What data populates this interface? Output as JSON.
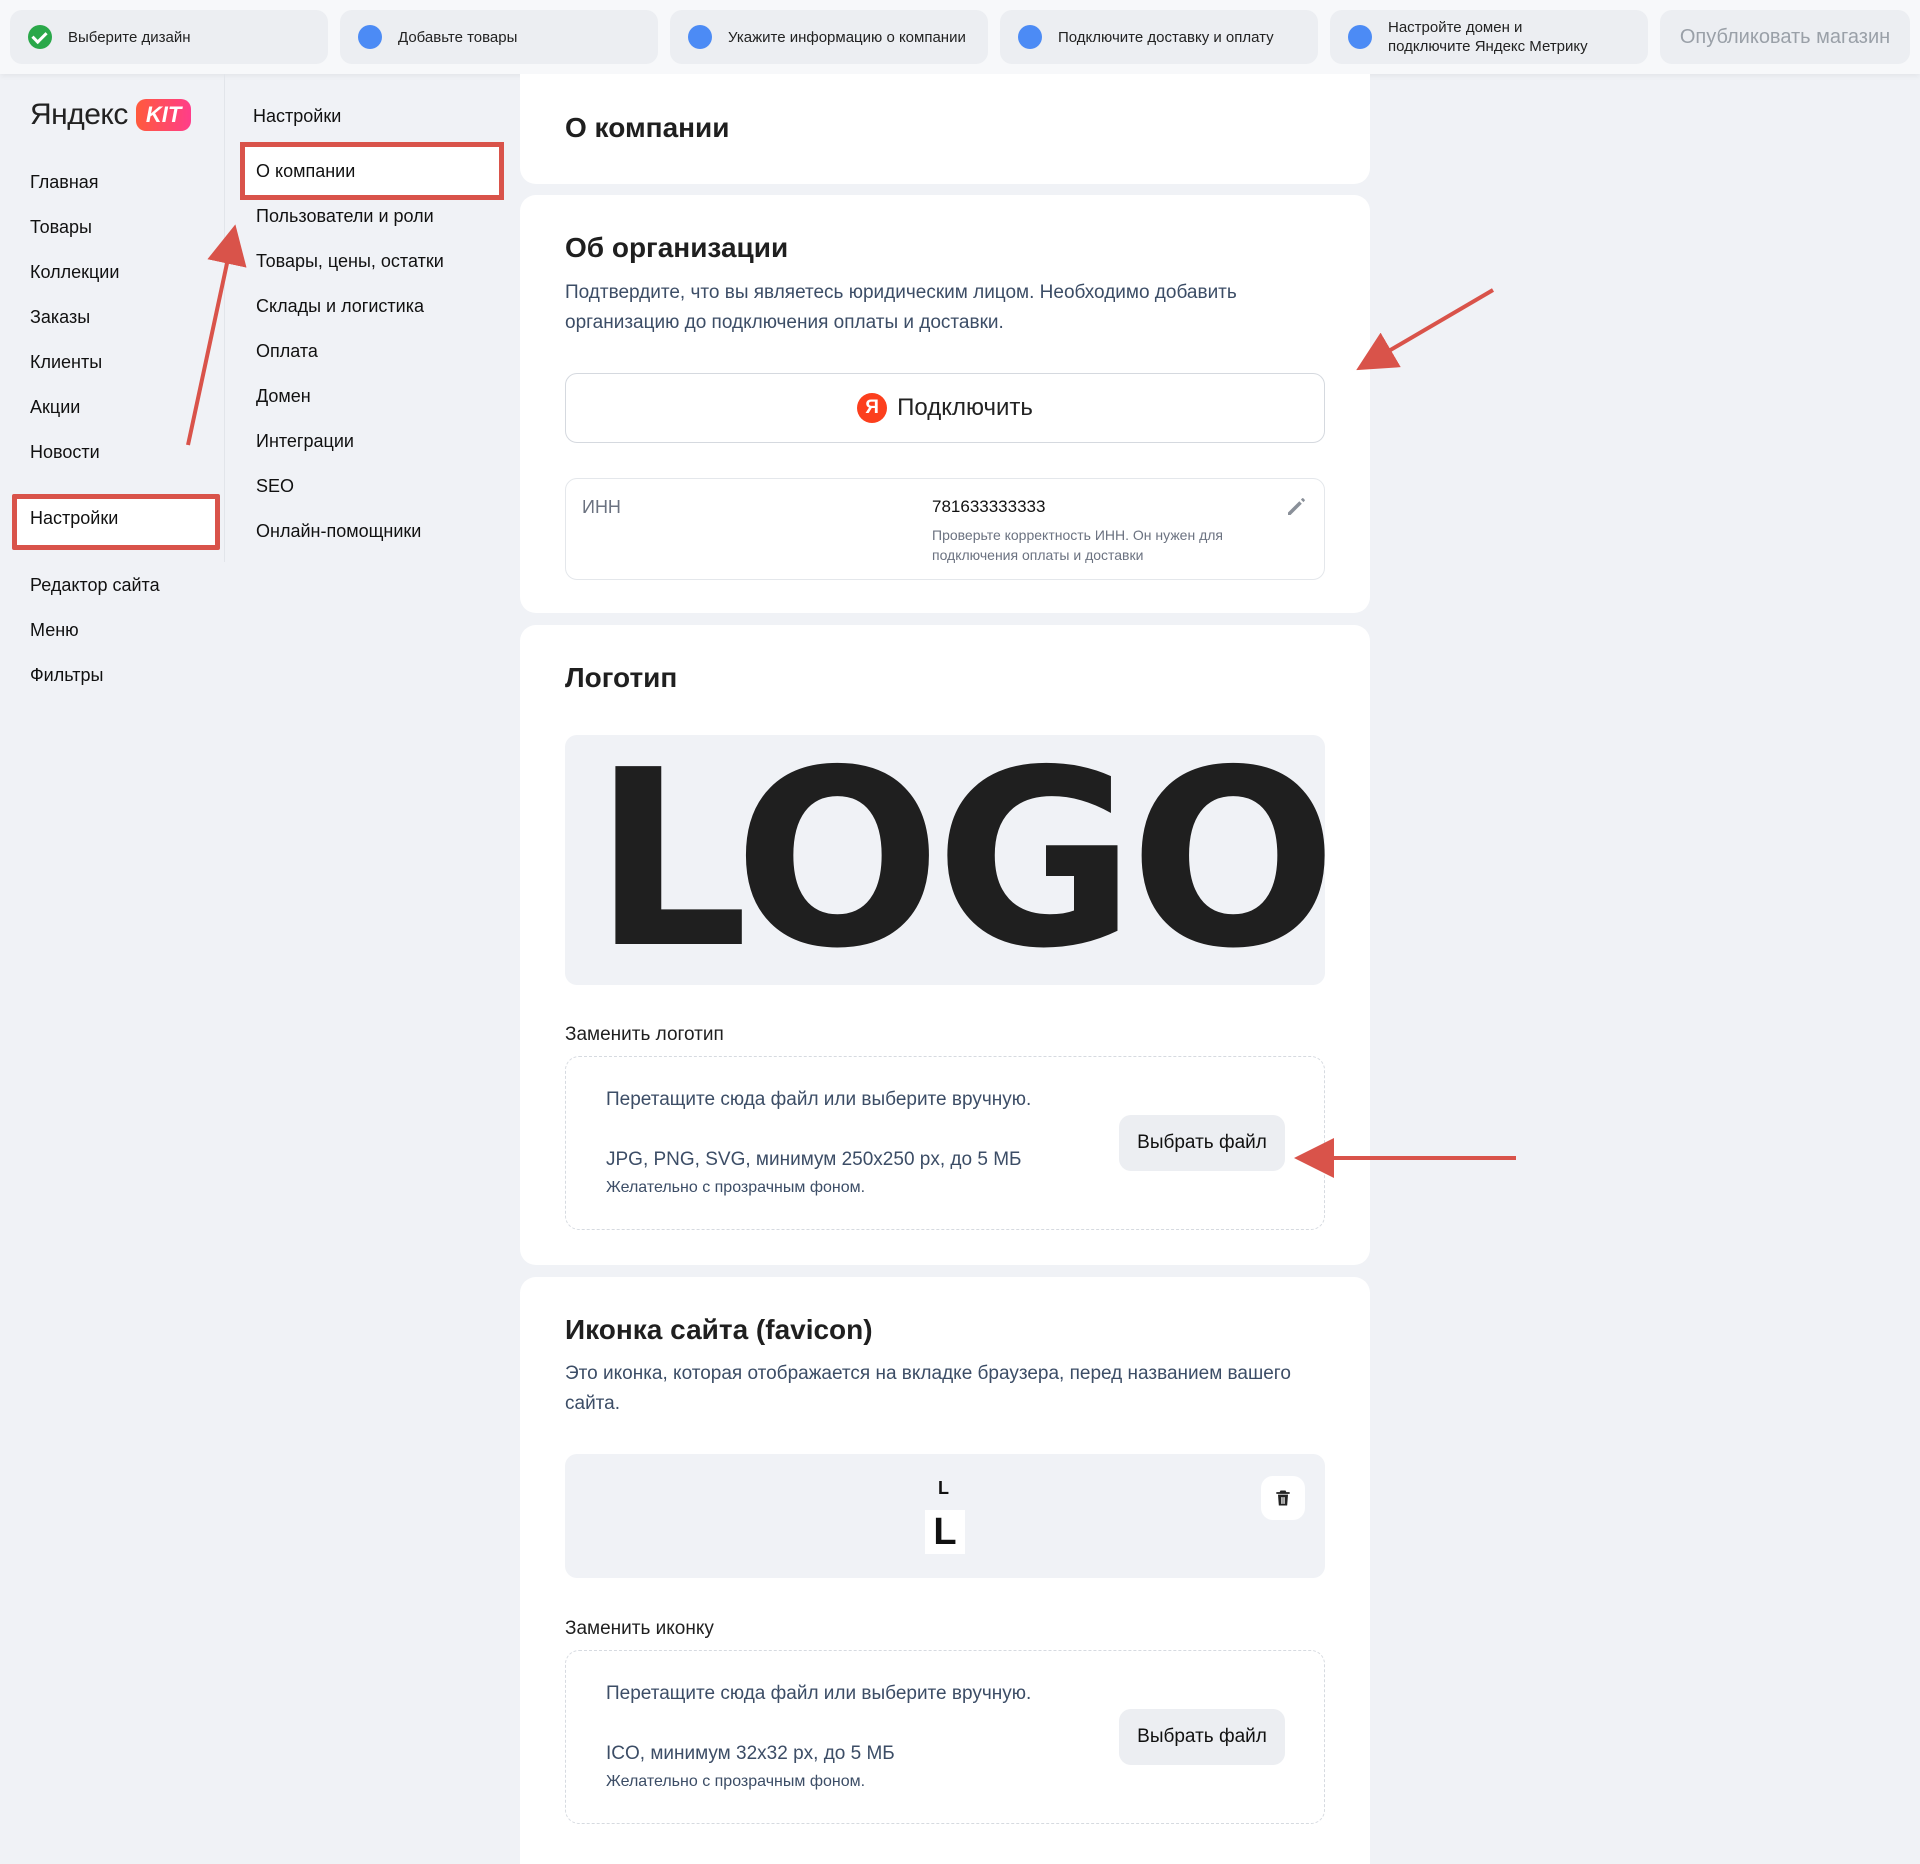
{
  "steps": [
    {
      "label": "Выберите дизайн",
      "done": true
    },
    {
      "label": "Добавьте товары",
      "done": false
    },
    {
      "label": "Укажите информацию о компании",
      "done": false
    },
    {
      "label": "Подключите доставку и оплату",
      "done": false
    },
    {
      "label": "Настройте домен и подключите Яндекс Метрику",
      "done": false
    }
  ],
  "publish_label": "Опубликовать магазин",
  "brand": {
    "name": "Яндекс",
    "badge": "KIT"
  },
  "sidebar": {
    "items": [
      {
        "label": "Главная"
      },
      {
        "label": "Товары"
      },
      {
        "label": "Коллекции"
      },
      {
        "label": "Заказы"
      },
      {
        "label": "Клиенты"
      },
      {
        "label": "Акции"
      },
      {
        "label": "Новости"
      },
      {
        "label": "Настройки",
        "selected": true
      },
      {
        "label": "Редактор сайта"
      },
      {
        "label": "Меню"
      },
      {
        "label": "Фильтры"
      }
    ]
  },
  "submenu": {
    "title": "Настройки",
    "items": [
      {
        "label": "О компании",
        "selected": true
      },
      {
        "label": "Пользователи и роли"
      },
      {
        "label": "Товары, цены, остатки"
      },
      {
        "label": "Склады и логистика"
      },
      {
        "label": "Оплата"
      },
      {
        "label": "Домен"
      },
      {
        "label": "Интеграции"
      },
      {
        "label": "SEO"
      },
      {
        "label": "Онлайн-помощники"
      }
    ]
  },
  "page_title": "О компании",
  "org": {
    "title": "Об организации",
    "description": "Подтвердите, что вы являетесь юридическим лицом. Необходимо добавить организацию до подключения оплаты и доставки.",
    "connect_label": "Подключить",
    "ya_letter": "Я",
    "inn_label": "ИНН",
    "inn_value": "781633333333",
    "inn_hint": "Проверьте корректность ИНН. Он нужен для подключения оплаты и доставки"
  },
  "logo": {
    "title": "Логотип",
    "preview_text": "LOGO",
    "replace_label": "Заменить логотип",
    "drop_text": "Перетащите сюда файл или выберите вручную.",
    "formats": "JPG, PNG, SVG, минимум 250x250 px, до 5 МБ",
    "hint": "Желательно с прозрачным фоном.",
    "choose_label": "Выбрать файл"
  },
  "favicon": {
    "title": "Иконка сайта (favicon)",
    "description": "Это иконка, которая отображается на вкладке браузера, перед названием вашего сайта.",
    "preview_small": "L",
    "preview_big": "L",
    "replace_label": "Заменить иконку",
    "drop_text": "Перетащите сюда файл или выберите вручную.",
    "formats": "ICO, минимум 32x32 px, до 5 МБ",
    "hint": "Желательно с прозрачным фоном.",
    "choose_label": "Выбрать файл"
  },
  "colors": {
    "accent_blue": "#4c8bf5",
    "done_green": "#2aa84a",
    "highlight_red": "#d9534a",
    "yandex_red": "#fc3f1d"
  }
}
